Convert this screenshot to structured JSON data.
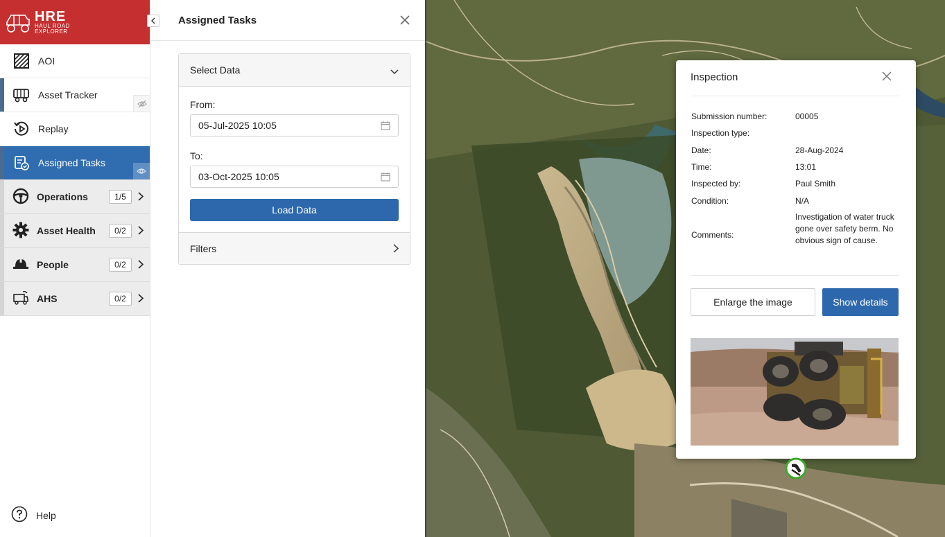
{
  "app": {
    "logo_main": "HRE",
    "logo_sub_1": "HAUL ROAD",
    "logo_sub_2": "EXPLORER"
  },
  "nav": {
    "items": [
      {
        "label": "AOI",
        "icon": "aoi-hatched-square-icon"
      },
      {
        "label": "Asset Tracker",
        "icon": "truck-icon"
      },
      {
        "label": "Replay",
        "icon": "replay-icon"
      },
      {
        "label": "Assigned Tasks",
        "icon": "task-clipboard-icon",
        "active": true
      }
    ],
    "categories": [
      {
        "label": "Operations",
        "count": "1/5",
        "icon": "steering-wheel-icon"
      },
      {
        "label": "Asset Health",
        "count": "0/2",
        "icon": "gear-icon"
      },
      {
        "label": "People",
        "count": "0/2",
        "icon": "hard-hat-icon"
      },
      {
        "label": "AHS",
        "count": "0/2",
        "icon": "autonomous-truck-icon"
      }
    ],
    "help_label": "Help"
  },
  "panel": {
    "title": "Assigned Tasks",
    "select_data_label": "Select Data",
    "from_label": "From:",
    "from_value": "05-Jul-2025 10:05",
    "to_label": "To:",
    "to_value": "03-Oct-2025 10:05",
    "load_button": "Load Data",
    "filters_label": "Filters"
  },
  "inspection": {
    "title": "Inspection",
    "fields": [
      {
        "label": "Submission number:",
        "value": "00005"
      },
      {
        "label": "Inspection type:",
        "value": ""
      },
      {
        "label": "Date:",
        "value": "28-Aug-2024"
      },
      {
        "label": "Time:",
        "value": "13:01"
      },
      {
        "label": "Inspected by:",
        "value": "Paul Smith"
      },
      {
        "label": "Condition:",
        "value": "N/A"
      },
      {
        "label": "Comments:",
        "value": "Investigation of water truck gone over safety berm. No obvious sign of cause."
      }
    ],
    "enlarge_button": "Enlarge the image",
    "details_button": "Show details"
  },
  "colors": {
    "brand_red": "#c62f2f",
    "active_blue": "#2f6db0",
    "button_blue": "#2d68ad"
  }
}
